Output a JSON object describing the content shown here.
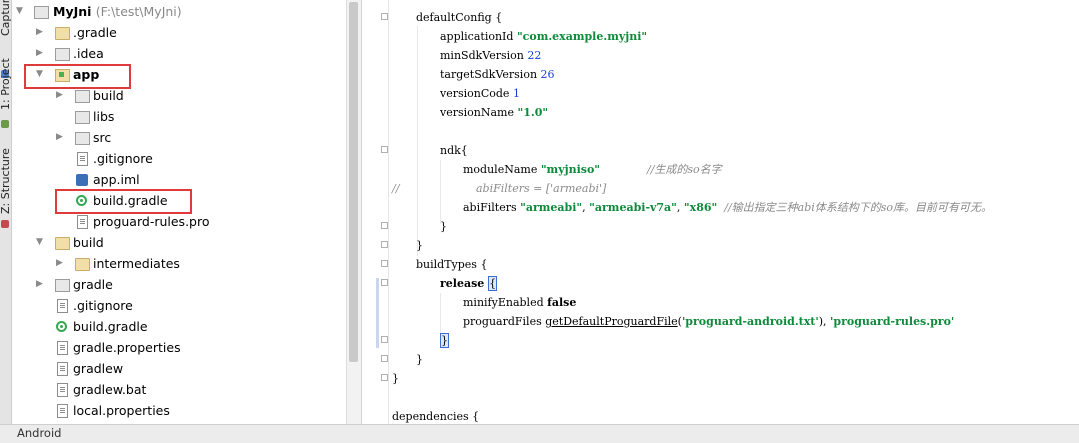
{
  "side_tabs": {
    "captures": "Captur",
    "project": "1: Project",
    "structure": "Z: Structure"
  },
  "tree": {
    "root_name": "MyJni",
    "root_path": "(F:\\test\\MyJni)",
    "items": [
      {
        "label": "MyJni"
      },
      {
        "label": ".gradle"
      },
      {
        "label": ".idea"
      },
      {
        "label": "app"
      },
      {
        "label": "build"
      },
      {
        "label": "libs"
      },
      {
        "label": "src"
      },
      {
        "label": ".gitignore"
      },
      {
        "label": "app.iml"
      },
      {
        "label": "build.gradle"
      },
      {
        "label": "proguard-rules.pro"
      },
      {
        "label": "build"
      },
      {
        "label": "intermediates"
      },
      {
        "label": "gradle"
      },
      {
        "label": ".gitignore"
      },
      {
        "label": "build.gradle"
      },
      {
        "label": "gradle.properties"
      },
      {
        "label": "gradlew"
      },
      {
        "label": "gradlew.bat"
      },
      {
        "label": "local.properties"
      }
    ]
  },
  "code": {
    "l1": "defaultConfig {",
    "l2_key": "applicationId ",
    "l2_val": "\"com.example.myjni\"",
    "l3_key": "minSdkVersion ",
    "l3_val": "22",
    "l4_key": "targetSdkVersion ",
    "l4_val": "26",
    "l5_key": "versionCode ",
    "l5_val": "1",
    "l6_key": "versionName ",
    "l6_val": "\"1.0\"",
    "l8": "ndk{",
    "l9_key": "moduleName ",
    "l9_val": "\"myjniso\"",
    "l9_cmt": "//生成的so名字",
    "l10_slashes": "//",
    "l10_cmt": "abiFilters = ['armeabi']",
    "l11_key": "abiFilters ",
    "l11_v1": "\"armeabi\"",
    "l11_v2": "\"armeabi-v7a\"",
    "l11_v3": "\"x86\"",
    "l11_cmt": "//输出指定三种abi体系结构下的so库。目前可有可无。",
    "l12": "}",
    "l13": "}",
    "l14": "buildTypes {",
    "l15_kw": "release ",
    "l15_brace": "{",
    "l16_key": "minifyEnabled ",
    "l16_val": "false",
    "l17_key": "proguardFiles ",
    "l17_fn": "getDefaultProguardFile",
    "l17_open": "(",
    "l17_a1": "'proguard-android.txt'",
    "l17_close": "), ",
    "l17_a2": "'proguard-rules.pro'",
    "l18": "}",
    "l19": "}",
    "l20": "}",
    "l22": "dependencies {"
  },
  "bottom_bar": {
    "label": "Android"
  },
  "colors": {
    "highlight_box": "#e03a3a",
    "string": "#0d8a3a",
    "number": "#1a3ed6",
    "gradle_icon": "#34a853"
  }
}
